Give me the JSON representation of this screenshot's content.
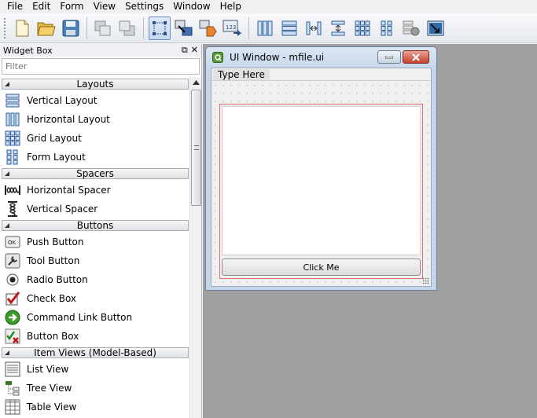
{
  "menubar": {
    "items": [
      {
        "label": "File"
      },
      {
        "label": "Edit"
      },
      {
        "label": "Form"
      },
      {
        "label": "View"
      },
      {
        "label": "Settings"
      },
      {
        "label": "Window"
      },
      {
        "label": "Help"
      }
    ]
  },
  "toolbar": {
    "groups": [
      [
        "new-file-icon",
        "open-folder-icon",
        "save-disk-icon"
      ],
      [
        "send-back-icon",
        "bring-front-icon"
      ],
      [
        "edit-widgets-icon",
        "edit-signals-icon",
        "edit-buddies-icon",
        "edit-tab-order-icon"
      ],
      [
        "layout-horizontal-icon",
        "layout-vertical-icon",
        "splitter-horizontal-icon",
        "splitter-vertical-icon",
        "layout-grid-icon",
        "layout-form-icon",
        "break-layout-icon",
        "adjust-size-icon"
      ]
    ],
    "active": "edit-widgets-icon"
  },
  "widgetbox": {
    "title": "Widget Box",
    "title_buttons": [
      "⧉",
      "✕"
    ],
    "filter_placeholder": "Filter",
    "categories": [
      {
        "label": "Layouts",
        "items": [
          {
            "label": "Vertical Layout",
            "icon": "vertical-layout-icon"
          },
          {
            "label": "Horizontal Layout",
            "icon": "horizontal-layout-icon"
          },
          {
            "label": "Grid Layout",
            "icon": "grid-layout-icon"
          },
          {
            "label": "Form Layout",
            "icon": "form-layout-icon"
          }
        ]
      },
      {
        "label": "Spacers",
        "items": [
          {
            "label": "Horizontal Spacer",
            "icon": "horizontal-spacer-icon"
          },
          {
            "label": "Vertical Spacer",
            "icon": "vertical-spacer-icon"
          }
        ]
      },
      {
        "label": "Buttons",
        "items": [
          {
            "label": "Push Button",
            "icon": "push-button-icon"
          },
          {
            "label": "Tool Button",
            "icon": "tool-button-icon"
          },
          {
            "label": "Radio Button",
            "icon": "radio-button-icon"
          },
          {
            "label": "Check Box",
            "icon": "check-box-icon"
          },
          {
            "label": "Command Link Button",
            "icon": "command-link-icon"
          },
          {
            "label": "Button Box",
            "icon": "button-box-icon"
          }
        ]
      },
      {
        "label": "Item Views (Model-Based)",
        "items": [
          {
            "label": "List View",
            "icon": "list-view-icon"
          },
          {
            "label": "Tree View",
            "icon": "tree-view-icon"
          },
          {
            "label": "Table View",
            "icon": "table-view-icon"
          }
        ]
      }
    ]
  },
  "form_window": {
    "title": "UI Window - mfile.ui",
    "menu_placeholder": "Type Here",
    "button_label": "Click Me"
  },
  "colors": {
    "layout_frame": "#e26a6a",
    "mdi_background": "#a0a0a0",
    "titlebar": "#c6d6ea"
  }
}
